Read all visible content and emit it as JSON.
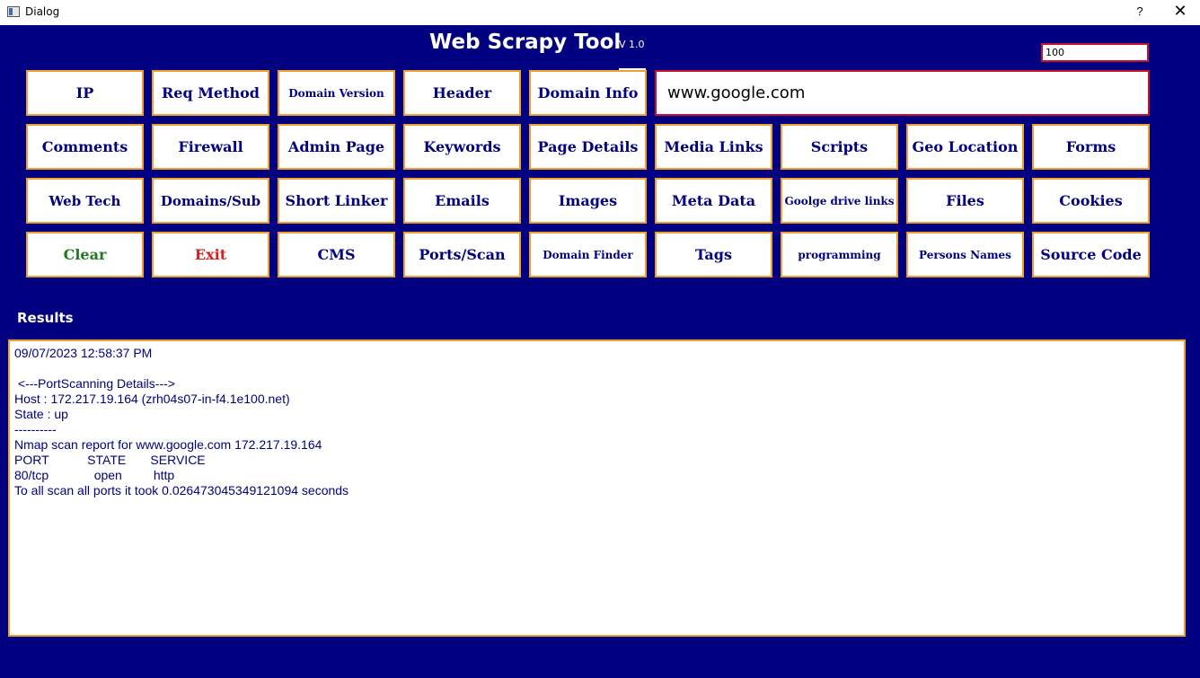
{
  "window": {
    "title": "Dialog",
    "help_label": "?",
    "close_label": "✕"
  },
  "header": {
    "title": "Web Scrapy Tool",
    "version": "V 1.0"
  },
  "inputs": {
    "count_value": "100",
    "url_value": "www.google.com"
  },
  "buttons": {
    "row1": [
      "IP",
      "Req Method",
      "Domain Version",
      "Header",
      "Domain Info"
    ],
    "row2": [
      "Comments",
      "Firewall",
      "Admin Page",
      "Keywords",
      "Page Details",
      "Media Links",
      "Scripts",
      "Geo Location",
      "Forms"
    ],
    "row3": [
      "Web Tech",
      "Domains/Sub",
      "Short Linker",
      "Emails",
      "Images",
      "Meta Data",
      "Goolge drive links",
      "Files",
      "Cookies"
    ],
    "row4": [
      "Clear",
      "Exit",
      "CMS",
      "Ports/Scan",
      "Domain Finder",
      "Tags",
      "programming",
      "Persons Names",
      "Source Code"
    ]
  },
  "results": {
    "label": "Results",
    "lines": [
      "09/07/2023 12:58:37 PM",
      "",
      " <---PortScanning Details--->",
      "Host : 172.217.19.164 (zrh04s07-in-f4.1e100.net)",
      "State : up",
      "----------",
      "Nmap scan report for www.google.com 172.217.19.164",
      "PORT           STATE       SERVICE",
      "80/tcp             open         http",
      "To all scan all ports it took 0.026473045349121094 seconds"
    ]
  },
  "colors": {
    "background": "#000080",
    "button_border": "#f0a030",
    "input_border": "#c8102e",
    "clear_text": "#1e7b1e",
    "exit_text": "#dd1c1c"
  }
}
